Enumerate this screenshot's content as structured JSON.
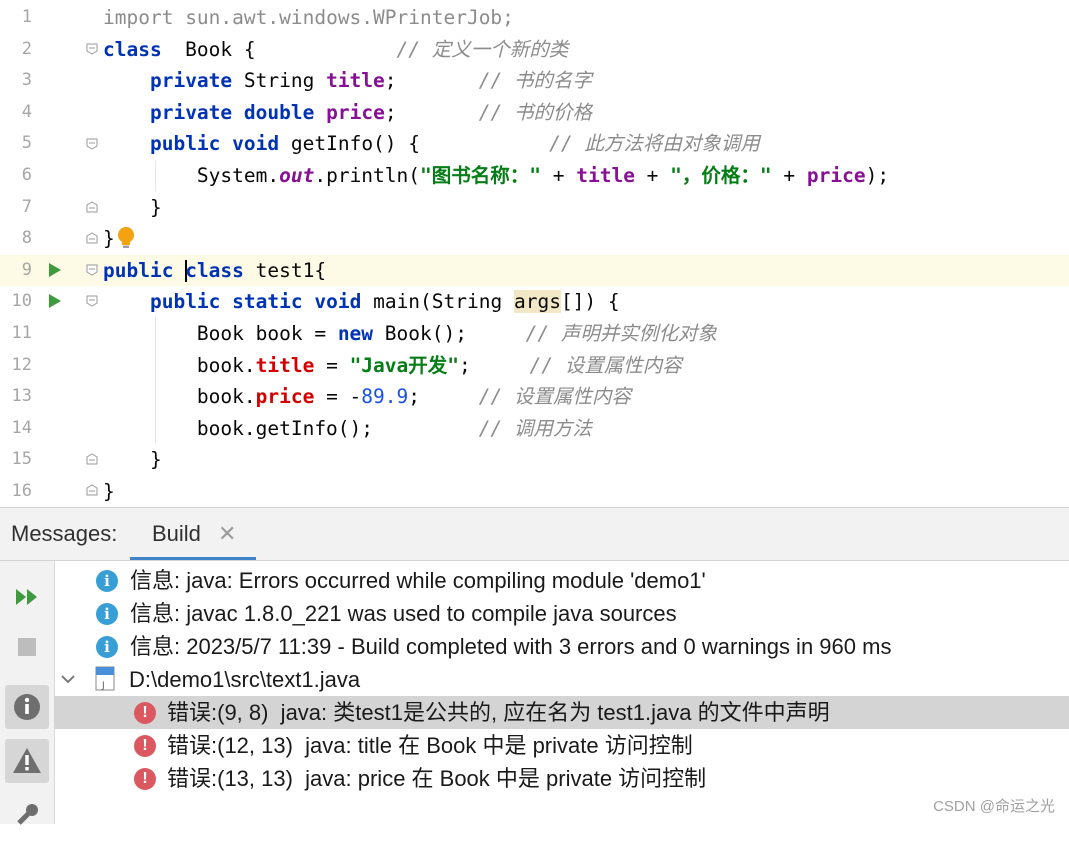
{
  "editor": {
    "lines": [
      {
        "n": "1",
        "segs": [
          [
            "gray",
            "import"
          ],
          [
            "gray",
            " sun.awt.windows.WPrinterJob;"
          ]
        ]
      },
      {
        "n": "2",
        "segs": [
          [
            "kw",
            "class"
          ],
          [
            "",
            "  Book {            "
          ],
          [
            "cmt",
            "// 定义一个新的类"
          ]
        ]
      },
      {
        "n": "3",
        "segs": [
          [
            "",
            "    "
          ],
          [
            "kw",
            "private"
          ],
          [
            "",
            " String "
          ],
          [
            "fld",
            "title"
          ],
          [
            "",
            ";       "
          ],
          [
            "cmt",
            "// 书的名字"
          ]
        ]
      },
      {
        "n": "4",
        "segs": [
          [
            "",
            "    "
          ],
          [
            "kw",
            "private"
          ],
          [
            "",
            " "
          ],
          [
            "kw",
            "double"
          ],
          [
            "",
            " "
          ],
          [
            "fld",
            "price"
          ],
          [
            "",
            ";       "
          ],
          [
            "cmt",
            "// 书的价格"
          ]
        ]
      },
      {
        "n": "5",
        "segs": [
          [
            "",
            "    "
          ],
          [
            "kw",
            "public"
          ],
          [
            "",
            " "
          ],
          [
            "kw",
            "void"
          ],
          [
            "",
            " getInfo() {           "
          ],
          [
            "cmt",
            "// 此方法将由对象调用"
          ]
        ]
      },
      {
        "n": "6",
        "segs": [
          [
            "",
            "        System."
          ],
          [
            "st",
            "out"
          ],
          [
            "",
            ".println("
          ],
          [
            "str",
            "\"图书名称：\""
          ],
          [
            "",
            " + "
          ],
          [
            "fld",
            "title"
          ],
          [
            "",
            " + "
          ],
          [
            "str",
            "\"，价格：\""
          ],
          [
            "",
            " + "
          ],
          [
            "fld",
            "price"
          ],
          [
            "",
            ");"
          ]
        ]
      },
      {
        "n": "7",
        "segs": [
          [
            "",
            "    }"
          ]
        ]
      },
      {
        "n": "8",
        "segs": [
          [
            "",
            "}"
          ]
        ]
      },
      {
        "n": "9",
        "segs": [
          [
            "kw",
            "public"
          ],
          [
            "",
            " "
          ],
          [
            "caret",
            ""
          ],
          [
            "kw",
            "class"
          ],
          [
            "",
            " test1{"
          ]
        ]
      },
      {
        "n": "10",
        "segs": [
          [
            "",
            "    "
          ],
          [
            "kw",
            "public"
          ],
          [
            "",
            " "
          ],
          [
            "kw",
            "static"
          ],
          [
            "",
            " "
          ],
          [
            "kw",
            "void"
          ],
          [
            "",
            " main(String "
          ],
          [
            "hl",
            "args"
          ],
          [
            "",
            "[]) {"
          ]
        ]
      },
      {
        "n": "11",
        "segs": [
          [
            "",
            "        Book book = "
          ],
          [
            "kw",
            "new"
          ],
          [
            "",
            " Book();     "
          ],
          [
            "cmt",
            "// 声明并实例化对象"
          ]
        ]
      },
      {
        "n": "12",
        "segs": [
          [
            "",
            "        book."
          ],
          [
            "fld-err",
            "title"
          ],
          [
            "",
            " = "
          ],
          [
            "str",
            "\"Java开发\""
          ],
          [
            "",
            ";     "
          ],
          [
            "cmt",
            "// 设置属性内容"
          ]
        ]
      },
      {
        "n": "13",
        "segs": [
          [
            "",
            "        book."
          ],
          [
            "fld-err",
            "price"
          ],
          [
            "",
            " = -"
          ],
          [
            "num",
            "89.9"
          ],
          [
            "",
            ";     "
          ],
          [
            "cmt",
            "// 设置属性内容"
          ]
        ]
      },
      {
        "n": "14",
        "segs": [
          [
            "",
            "        book.getInfo();         "
          ],
          [
            "cmt",
            "// 调用方法"
          ]
        ]
      },
      {
        "n": "15",
        "segs": [
          [
            "",
            "    }"
          ]
        ]
      },
      {
        "n": "16",
        "segs": [
          [
            "",
            "}"
          ]
        ]
      }
    ]
  },
  "panel": {
    "title": "Messages:",
    "tab_label": "Build",
    "tab_close": "✕",
    "messages": [
      {
        "type": "info",
        "indent": 0,
        "text": "信息: java: Errors occurred while compiling module 'demo1'"
      },
      {
        "type": "info",
        "indent": 0,
        "text": "信息: javac 1.8.0_221 was used to compile java sources"
      },
      {
        "type": "info",
        "indent": 0,
        "text": "信息: 2023/5/7 11:39 - Build completed with 3 errors and 0 warnings in 960 ms"
      },
      {
        "type": "file",
        "indent": 0,
        "text": "D:\\demo1\\src\\text1.java"
      },
      {
        "type": "error",
        "indent": 1,
        "text": "错误:(9, 8)  java: 类test1是公共的, 应在名为 test1.java 的文件中声明"
      },
      {
        "type": "error",
        "indent": 1,
        "text": "错误:(12, 13)  java: title 在 Book 中是 private 访问控制"
      },
      {
        "type": "error",
        "indent": 1,
        "text": "错误:(13, 13)  java: price 在 Book 中是 private 访问控制"
      }
    ]
  },
  "watermark": "CSDN @命运之光",
  "colors": {
    "keyword": "#0033b3",
    "field": "#871094",
    "string": "#067d17",
    "comment": "#8c8c8c",
    "run_icon": "#3d9a3d",
    "info_icon": "#389fd6",
    "error_icon": "#db5860",
    "tab_underline": "#4083c9"
  }
}
